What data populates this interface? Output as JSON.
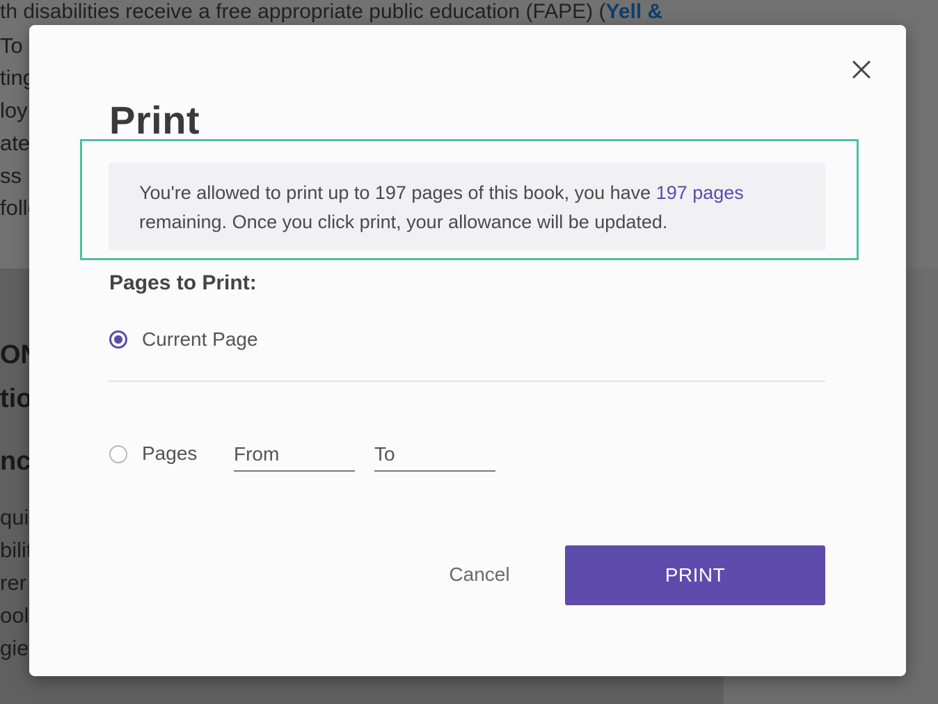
{
  "background": {
    "lines": [
      {
        "text": "th disabilities receive a free appropriate public education (FAPE) (",
        "link": "Yell &"
      },
      {
        "text": "To p"
      },
      {
        "text": "ting"
      },
      {
        "text": "loy"
      },
      {
        "text": "ate"
      },
      {
        "text": "ss"
      },
      {
        "text": "follo"
      },
      {
        "text": "ON"
      },
      {
        "text": "tio"
      },
      {
        "text": "nc"
      },
      {
        "text": "quir"
      },
      {
        "text": "bilit"
      },
      {
        "text": "rer"
      },
      {
        "text": "ool"
      },
      {
        "text": "gie"
      }
    ]
  },
  "dialog": {
    "title": "Print",
    "close_icon": "close-icon",
    "info": {
      "text_before": "You're allowed to print up to 197 pages of this book, you have ",
      "link": "197 pages",
      "text_after": " remaining. Once you click print, your allowance will be updated."
    },
    "highlight_color": "#4fbf9f",
    "section_label": "Pages to Print:",
    "options": [
      {
        "label": "Current Page",
        "selected": true
      },
      {
        "label": "Pages",
        "selected": false
      }
    ],
    "from_placeholder": "From",
    "to_placeholder": "To",
    "cancel_label": "Cancel",
    "print_label": "PRINT",
    "accent_color": "#5d4cab"
  }
}
